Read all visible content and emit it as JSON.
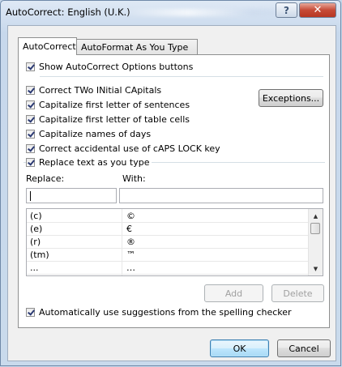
{
  "window": {
    "title": "AutoCorrect: English (U.K.)",
    "help_glyph": "?",
    "close_glyph": "✕"
  },
  "tabs": [
    {
      "label": "AutoCorrect",
      "active": true
    },
    {
      "label": "AutoFormat As You Type",
      "active": false
    }
  ],
  "options": {
    "show_buttons": "Show AutoCorrect Options buttons",
    "two_initial": "Correct TWo INitial CApitals",
    "first_letter_sentences": "Capitalize first letter of sentences",
    "first_letter_table": "Capitalize first letter of table cells",
    "names_of_days": "Capitalize names of days",
    "caps_lock": "Correct accidental use of cAPS LOCK key",
    "replace_text": "Replace text as you type",
    "spelling_suggestions": "Automatically use suggestions from the spelling checker"
  },
  "buttons": {
    "exceptions": "Exceptions...",
    "add": "Add",
    "delete": "Delete",
    "ok": "OK",
    "cancel": "Cancel"
  },
  "replace": {
    "replace_label": "Replace:",
    "with_label": "With:",
    "replace_value": "",
    "with_value": ""
  },
  "list": {
    "rows": [
      {
        "replace": "(c)",
        "with": "©"
      },
      {
        "replace": "(e)",
        "with": "€"
      },
      {
        "replace": "(r)",
        "with": "®"
      },
      {
        "replace": "(tm)",
        "with": "™"
      },
      {
        "replace": "...",
        "with": "…"
      }
    ],
    "scroll_up": "▲",
    "scroll_down": "▼"
  }
}
